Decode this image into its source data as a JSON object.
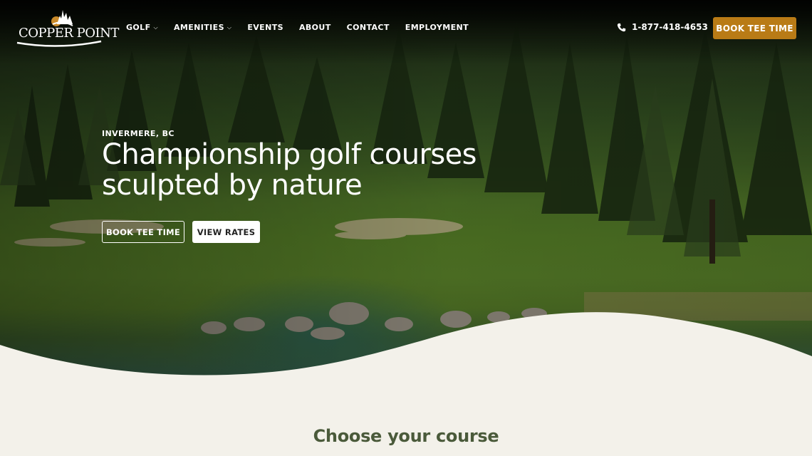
{
  "brand": {
    "name": "Copper Point",
    "logo_text": "COPPER POINT"
  },
  "nav": {
    "items": [
      {
        "label": "GOLF",
        "has_dropdown": true
      },
      {
        "label": "AMENITIES",
        "has_dropdown": true
      },
      {
        "label": "EVENTS",
        "has_dropdown": false
      },
      {
        "label": "ABOUT",
        "has_dropdown": false
      },
      {
        "label": "CONTACT",
        "has_dropdown": false
      },
      {
        "label": "EMPLOYMENT",
        "has_dropdown": false
      }
    ],
    "dropdown_glyph": "⌵"
  },
  "header": {
    "phone_icon": "phone-icon",
    "phone": "1-877-418-4653",
    "book_label": "BOOK TEE TIME"
  },
  "hero": {
    "kicker": "INVERMERE, BC",
    "headline_line1": "Championship golf courses",
    "headline_line2": "sculpted by nature",
    "primary_cta": "BOOK TEE TIME",
    "secondary_cta": "VIEW RATES"
  },
  "section": {
    "title": "Choose your course"
  },
  "colors": {
    "accent": "#b97b16",
    "cream": "#f3f1ea",
    "heading_green": "#4a5a3a"
  }
}
